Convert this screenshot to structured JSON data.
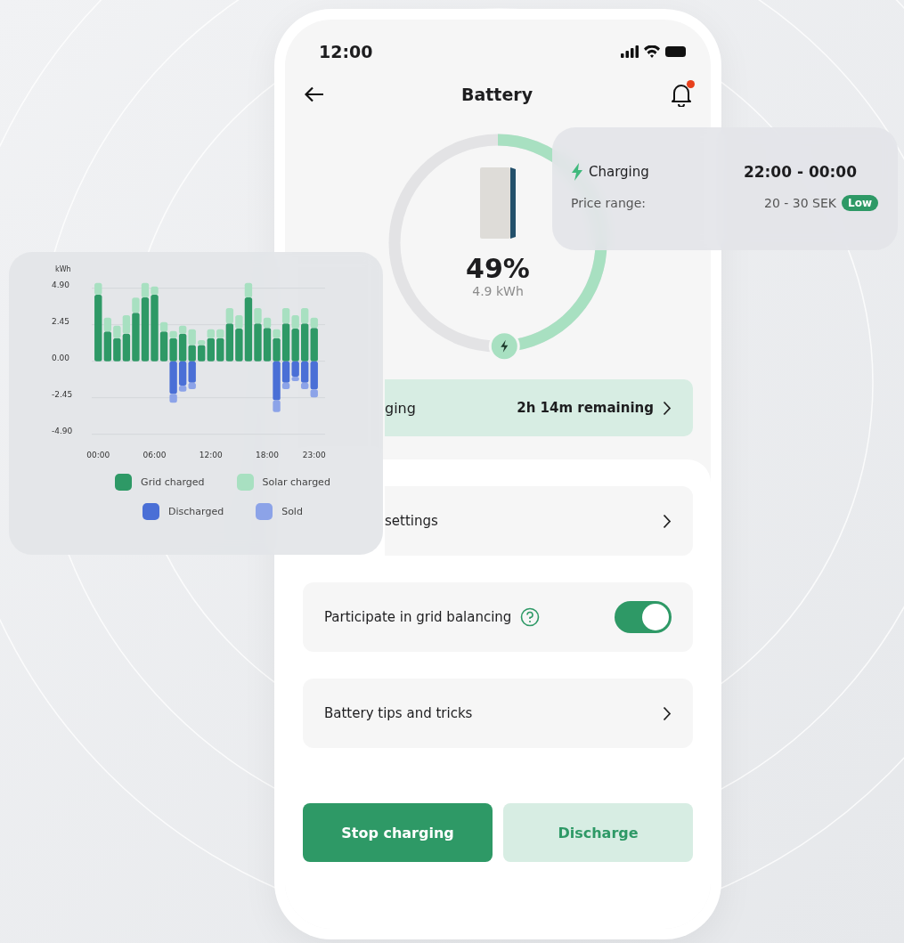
{
  "status_bar": {
    "time": "12:00"
  },
  "header": {
    "title": "Battery",
    "unread_notifications": true
  },
  "battery": {
    "level": 0.49,
    "percent": "49%",
    "energy": "4.9 kWh"
  },
  "charging_row": {
    "label": "ging",
    "remaining": "2h 14m remaining"
  },
  "settings_list": [
    {
      "kind": "link",
      "label": "settings"
    },
    {
      "kind": "toggle",
      "label": "Participate in grid balancing",
      "help": true,
      "on": true
    },
    {
      "kind": "link",
      "label": "Battery tips and tricks"
    }
  ],
  "actions": [
    {
      "label": "Stop charging",
      "primary": true
    },
    {
      "label": "Discharge",
      "primary": false
    }
  ],
  "price_card": {
    "status": "Charging",
    "time_range": "22:00 - 00:00",
    "price_label": "Price range:",
    "price": "20 - 30 SEK",
    "badge": "Low"
  },
  "chart_card": {
    "chart_data": {
      "type": "bar",
      "stacked": true,
      "ylabel": "kWh",
      "x": [
        0,
        1,
        2,
        3,
        4,
        5,
        6,
        7,
        8,
        9,
        10,
        11,
        12,
        13,
        14,
        15,
        16,
        17,
        18,
        19,
        20,
        21,
        22,
        23
      ],
      "xticks": [
        {
          "value": 0,
          "label": "00:00"
        },
        {
          "value": 6,
          "label": "06:00"
        },
        {
          "value": 12,
          "label": "12:00"
        },
        {
          "value": 18,
          "label": "18:00"
        },
        {
          "value": 23,
          "label": "23:00"
        }
      ],
      "yticks": [
        {
          "value": 4.9,
          "label": "4.90"
        },
        {
          "value": 2.45,
          "label": "2.45"
        },
        {
          "value": 0,
          "label": "0.00"
        },
        {
          "value": -2.45,
          "label": "-2.45"
        },
        {
          "value": -4.9,
          "label": "-4.90"
        }
      ],
      "ylim": [
        -4.9,
        5.3
      ],
      "xlim": [
        -0.5,
        23.5
      ],
      "grid": true,
      "series": [
        {
          "name": "Grid charged",
          "color": "#2e9966",
          "values": [
            4.47,
            2.0,
            1.55,
            1.85,
            3.25,
            4.29,
            4.47,
            2.0,
            1.55,
            1.85,
            1.08,
            1.08,
            1.55,
            1.55,
            2.54,
            2.19,
            4.29,
            2.54,
            2.24,
            1.55,
            2.54,
            2.19,
            2.54,
            2.24
          ]
        },
        {
          "name": "Solar charged",
          "color": "#a8e0c1",
          "values": [
            0.79,
            0.93,
            0.83,
            1.24,
            1.02,
            0.97,
            0.55,
            0.62,
            0.48,
            0.53,
            1.07,
            0.34,
            0.6,
            0.6,
            1.02,
            0.9,
            0.97,
            1.02,
            0.69,
            0.6,
            1.02,
            0.9,
            1.02,
            0.69
          ]
        },
        {
          "name": "Discharged",
          "color": "#4a6fd6",
          "values": [
            0,
            0,
            0,
            0,
            0,
            0,
            0,
            0,
            -2.19,
            -1.63,
            -1.44,
            0,
            0,
            0,
            0,
            0,
            0,
            0,
            0,
            -2.62,
            -1.44,
            -1.04,
            -1.44,
            -1.89
          ]
        },
        {
          "name": "Sold",
          "color": "#8ca3e8",
          "values": [
            0,
            0,
            0,
            0,
            0,
            0,
            0,
            0,
            -0.59,
            -0.4,
            -0.43,
            0,
            0,
            0,
            0,
            0,
            0,
            0,
            0,
            -0.79,
            -0.43,
            -0.3,
            -0.43,
            -0.53
          ]
        }
      ]
    }
  }
}
